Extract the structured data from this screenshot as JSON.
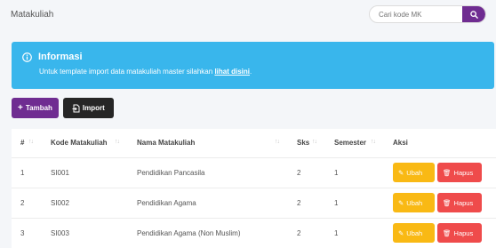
{
  "header": {
    "title": "Matakuliah",
    "search_placeholder": "Cari kode MK",
    "search_icon": "search-icon"
  },
  "info": {
    "title": "Informasi",
    "text": "Untuk template import data matakuliah master silahkan ",
    "link": "lihat disini",
    "suffix": ".",
    "icon": "info-circle-icon"
  },
  "actions": {
    "add_label": "Tambah",
    "add_icon": "plus-icon",
    "import_label": "Import",
    "import_icon": "file-import-icon"
  },
  "table": {
    "columns": [
      "#",
      "Kode Matakuliah",
      "Nama Matakuliah",
      "Sks",
      "Semester",
      "Aksi"
    ],
    "rows": [
      {
        "no": "1",
        "kode": "SI001",
        "nama": "Pendidikan Pancasila",
        "sks": "2",
        "semester": "1"
      },
      {
        "no": "2",
        "kode": "SI002",
        "nama": "Pendidikan Agama",
        "sks": "2",
        "semester": "1"
      },
      {
        "no": "3",
        "kode": "SI003",
        "nama": "Pendidikan Agama (Non Muslim)",
        "sks": "2",
        "semester": "1"
      }
    ],
    "edit_label": "Ubah",
    "delete_label": "Hapus",
    "edit_icon": "pencil-icon",
    "delete_icon": "trash-icon"
  },
  "colors": {
    "primary": "#6f2c91",
    "info": "#39b6ec",
    "dark": "#262626",
    "warning": "#f9b914",
    "danger": "#ef4b4b"
  }
}
